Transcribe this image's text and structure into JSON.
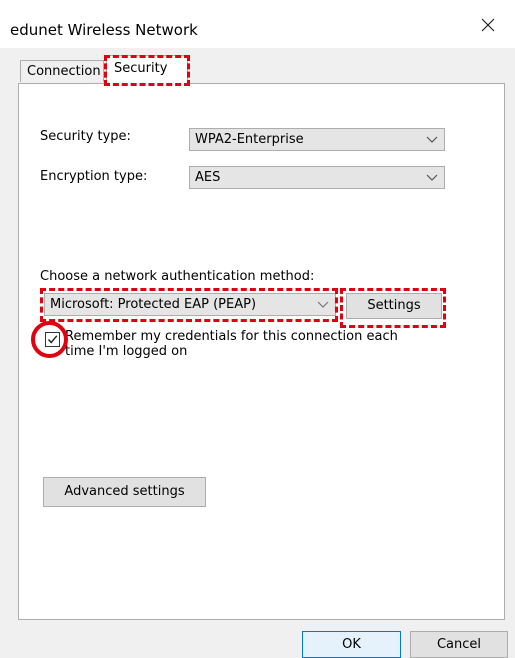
{
  "window": {
    "title": "edunet Wireless Network",
    "close_icon": "close-icon"
  },
  "tabs": [
    {
      "label": "Connection",
      "selected": false
    },
    {
      "label": "Security",
      "selected": true
    }
  ],
  "security": {
    "security_type_label": "Security type:",
    "security_type_value": "WPA2-Enterprise",
    "encryption_type_label": "Encryption type:",
    "encryption_type_value": "AES",
    "auth_method_label": "Choose a network authentication method:",
    "auth_method_value": "Microsoft: Protected EAP (PEAP)",
    "settings_button": "Settings",
    "remember_credentials_label": "Remember my credentials for this connection each time I'm logged on",
    "remember_credentials_checked": true,
    "advanced_settings_button": "Advanced settings"
  },
  "footer": {
    "ok_button": "OK",
    "cancel_button": "Cancel"
  },
  "colors": {
    "highlight": "#e0000e",
    "ok_border": "#0078d7"
  }
}
